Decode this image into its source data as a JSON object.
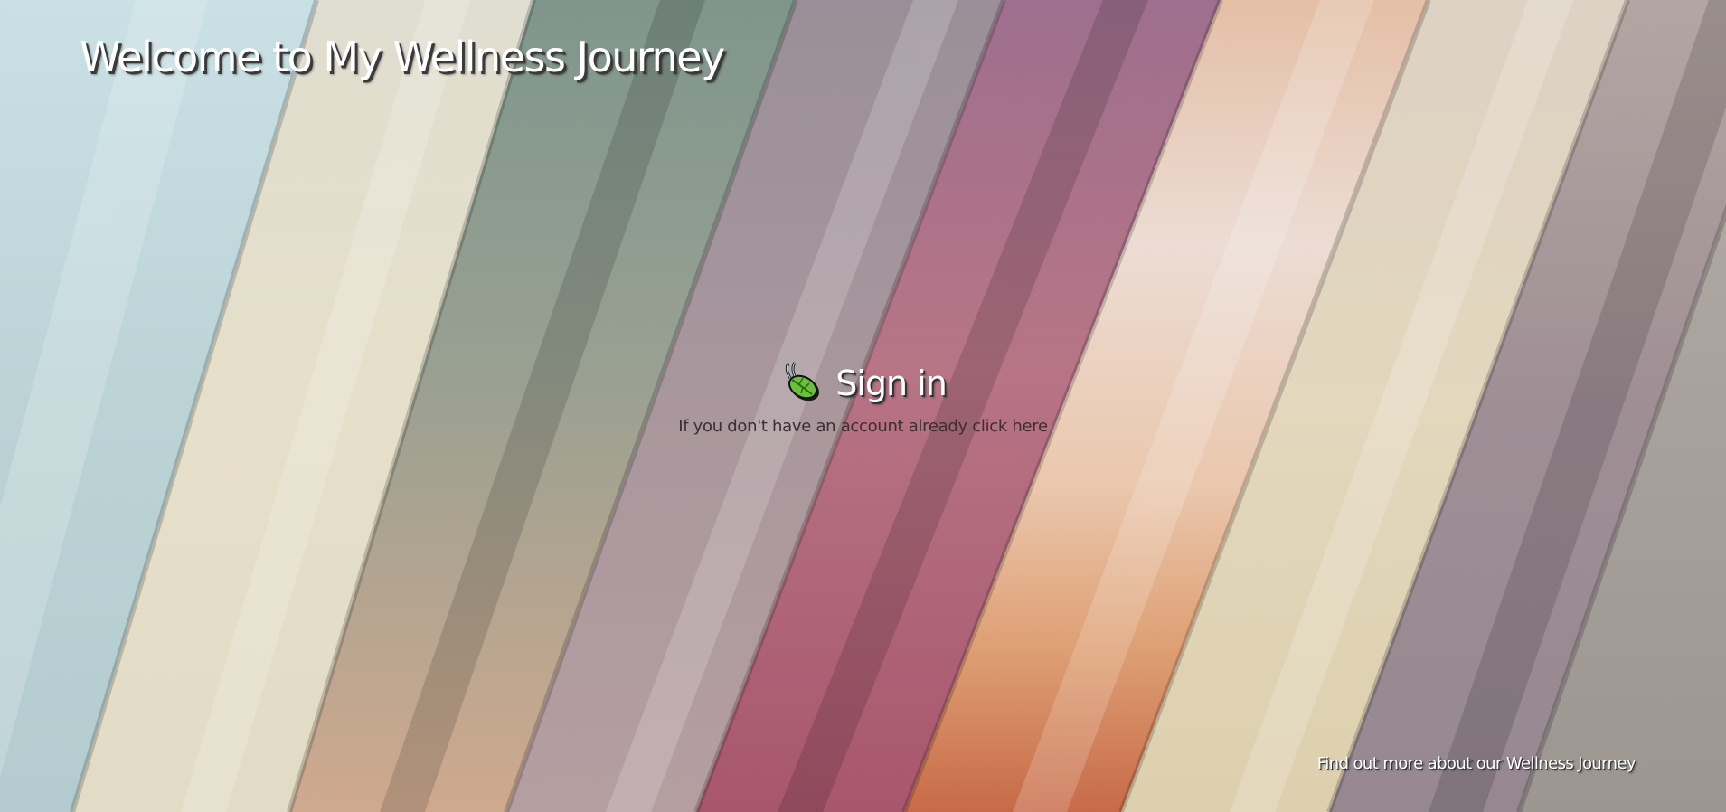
{
  "header": {
    "title": "Welcome to My Wellness Journey"
  },
  "signin": {
    "icon": "leaf-icon",
    "label": "Sign in",
    "signup_hint": "If you don't have an account already click here"
  },
  "footer": {
    "about_link": "Find out more about our Wellness Journey"
  },
  "background": {
    "style": "diagonal pastel stripes",
    "colors": [
      "#c6dce0",
      "#e3ddc8",
      "#8e9e92",
      "#a99aa3",
      "#b06e84",
      "#e6c9b2",
      "#ddd2b8",
      "#9c8e94",
      "#a8a09c"
    ]
  }
}
